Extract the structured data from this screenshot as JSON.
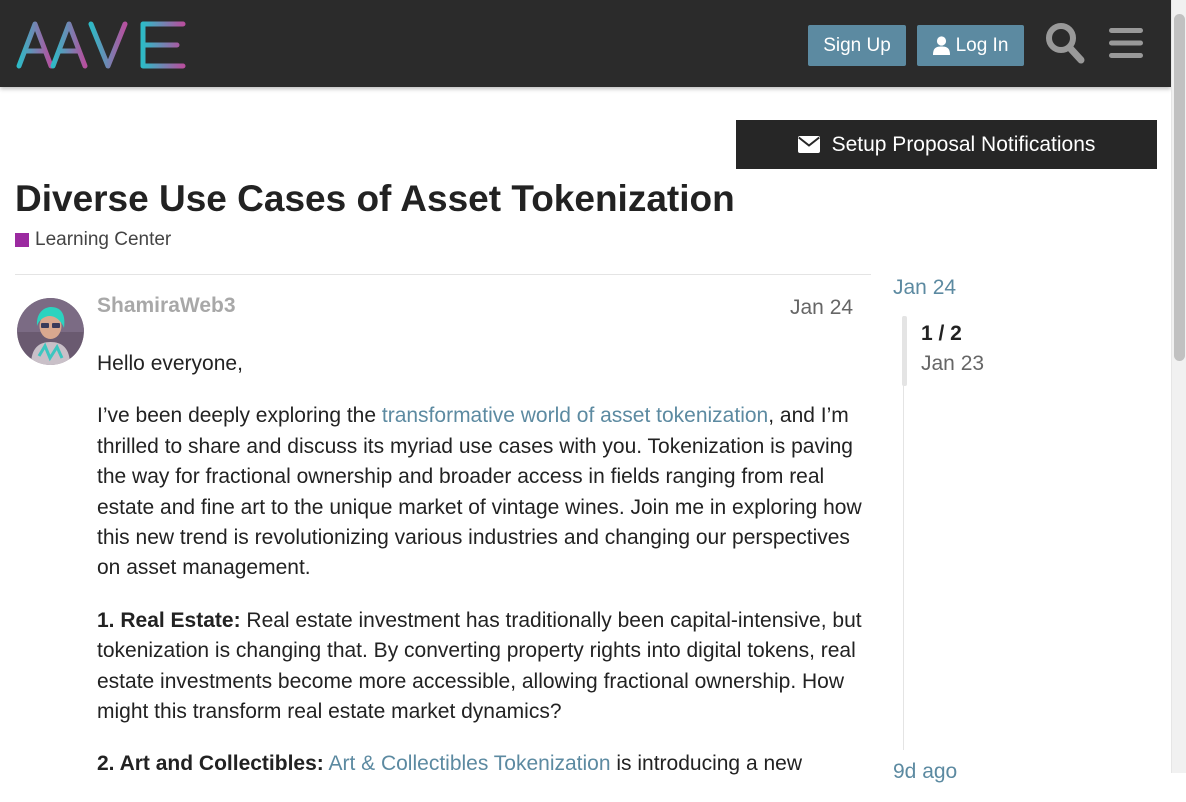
{
  "header": {
    "logo_alt": "AAVE",
    "signup_label": "Sign Up",
    "login_label": "Log In",
    "icons": [
      "person-icon",
      "search-icon",
      "hamburger-menu-icon"
    ],
    "bg_color": "#2b2b2b",
    "button_color": "#5c8aa1"
  },
  "banner": {
    "icon": "envelope-icon",
    "label": "Setup Proposal Notifications"
  },
  "topic": {
    "title": "Diverse Use Cases of Asset Tokenization",
    "category": "Learning Center",
    "category_color": "#9b2aa0"
  },
  "post": {
    "author": "ShamiraWeb3",
    "date": "Jan 24",
    "greeting": "Hello everyone,",
    "p1_before": "I’ve been deeply exploring the ",
    "p1_link": "transformative world of asset tokenization",
    "p1_after": ", and I’m thrilled to share and discuss its myriad use cases with you. Tokenization is paving the way for fractional ownership and broader access in fields ranging from real estate and fine art to the unique market of vintage wines. Join me in exploring how this new trend is revolutionizing various industries and changing our perspectives on asset management.",
    "section1_heading": "1. Real Estate:",
    "section1_text": " Real estate investment has traditionally been capital-intensive, but tokenization is changing that. By converting property rights into digital tokens, real estate investments become more accessible, allowing fractional ownership. How might this transform real estate market dynamics?",
    "section2_heading": "2. Art and Collectibles:",
    "section2_link": "Art & Collectibles Tokenization",
    "section2_text": " is introducing a new"
  },
  "timeline": {
    "top_date": "Jan 24",
    "position": "1 / 2",
    "position_date": "Jan 23",
    "bottom_date": "9d ago"
  }
}
